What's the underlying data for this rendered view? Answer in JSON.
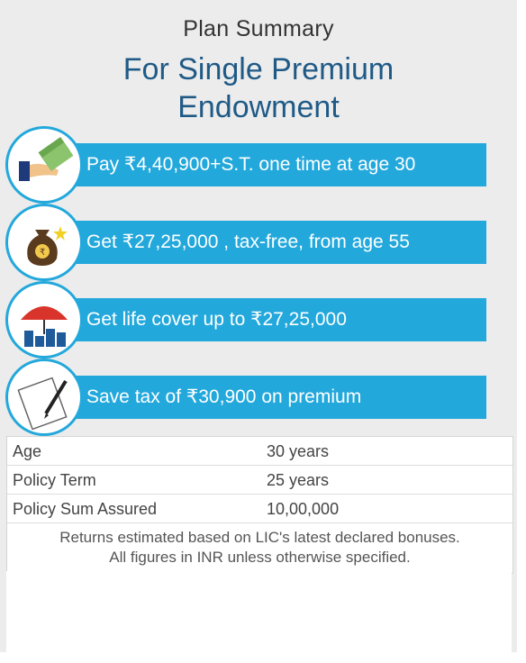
{
  "header": {
    "subtitle": "Plan Summary",
    "title_line1": "For Single Premium",
    "title_line2": "Endowment"
  },
  "benefits": [
    {
      "icon": "hand-cash-icon",
      "text": "Pay ₹4,40,900+S.T. one time at age 30"
    },
    {
      "icon": "money-bag-icon",
      "text": "Get ₹27,25,000 , tax-free, from age 55"
    },
    {
      "icon": "umbrella-icon",
      "text": "Get life cover up to ₹27,25,000"
    },
    {
      "icon": "document-pen-icon",
      "text": "Save tax of ₹30,900 on premium"
    }
  ],
  "summary_table": [
    {
      "label": "Age",
      "value": "30 years"
    },
    {
      "label": "Policy Term",
      "value": "25 years"
    },
    {
      "label": "Policy Sum Assured",
      "value": "10,00,000"
    }
  ],
  "note_line1": "Returns estimated based on LIC's latest declared bonuses.",
  "note_line2": "All figures in INR unless otherwise specified.",
  "colors": {
    "accent": "#23a8dc",
    "title": "#1f5a86",
    "background": "#ececec"
  }
}
